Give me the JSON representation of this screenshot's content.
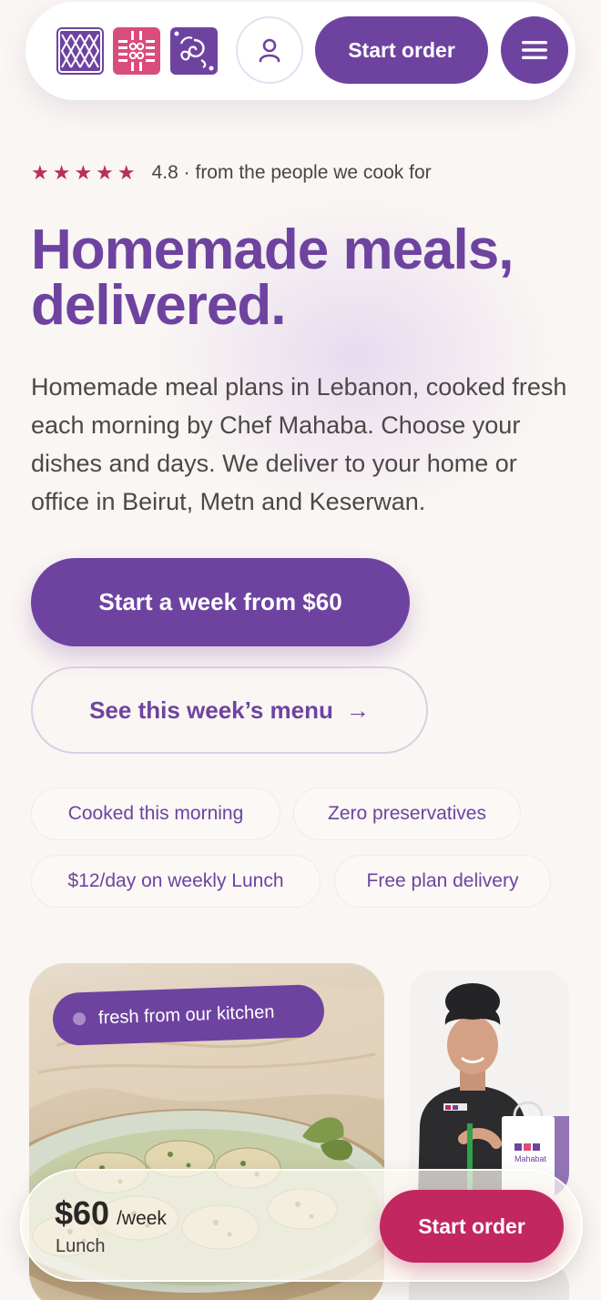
{
  "header": {
    "order_label": "Start order"
  },
  "rating": {
    "stars": "★★★★★",
    "text": "4.8 · from the people we cook for"
  },
  "hero": {
    "title_line1": "Homemade meals,",
    "title_line2": "delivered.",
    "description": "Homemade meal plans in Lebanon, cooked fresh each morning by Chef Mahaba. Choose your dishes and days. We deliver to your home or office in Beirut, Metn and Keserwan.",
    "primary_cta": "Start a week from $60",
    "secondary_cta": "See this week’s menu",
    "secondary_cta_arrow": "→"
  },
  "chips": [
    "Cooked this morning",
    "Zero preservatives",
    "$12/day on weekly Lunch",
    "Free plan delivery"
  ],
  "food_card": {
    "badge": "fresh from our kitchen"
  },
  "chef_card": {
    "bag_brand": "Mahabat"
  },
  "sticky_bar": {
    "price": "$60",
    "unit": "/week",
    "plan": "Lunch",
    "order_label": "Start order"
  },
  "colors": {
    "brand_purple": "#6e43a0",
    "brand_pink": "#d94d7d",
    "cta_magenta": "#c2275f",
    "star_red": "#b8305a",
    "background": "#faf6f3"
  },
  "icons": [
    "logo-lattice-icon",
    "logo-flower-grid-icon",
    "logo-rose-icon",
    "user-icon",
    "hamburger-menu-icon",
    "arrow-right-icon",
    "star-icon"
  ]
}
